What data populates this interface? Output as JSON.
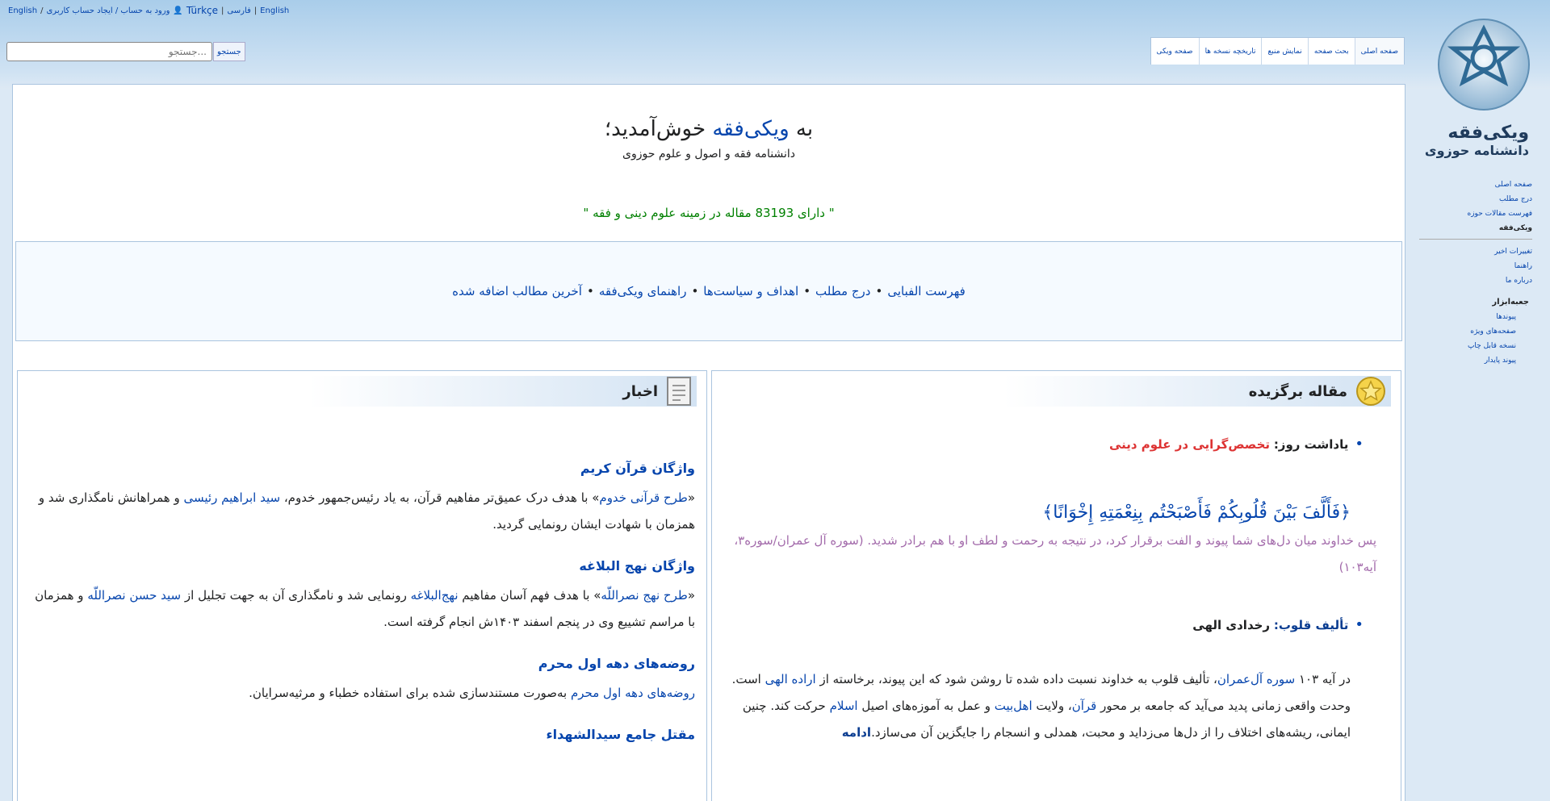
{
  "personal": {
    "items": [
      "ورود به حساب / ایجاد حساب کاربری",
      "Türkçe",
      "فارسی",
      "English"
    ]
  },
  "search": {
    "placeholder": "جستجو...",
    "button_label": "جستجو"
  },
  "tabs": [
    {
      "label": "صفحه اصلی",
      "selected": true
    },
    {
      "label": "بحث صفحه",
      "selected": false
    },
    {
      "label": "نمایش منبع",
      "selected": false
    },
    {
      "label": "تاریخچه نسخه ها",
      "selected": false
    },
    {
      "label": "صفحه ویکی",
      "selected": false
    }
  ],
  "logo": {
    "text_line1": "ویکی‌فقه",
    "text_line2": "دانشنامه حوزوی"
  },
  "sidebar": {
    "items1": [
      "صفحه اصلی",
      "درج مطلب",
      "فهرست مقالات حوزه",
      "ویکی‌فقه"
    ],
    "items2": [
      "تغییرات اخیر",
      "راهنما",
      "درباره ما"
    ],
    "section_head": "جعبه‌ابزار",
    "items3": [
      "پیوندها",
      "صفحه‌های ویژه",
      "نسخه قابل چاپ",
      "پیوند پایدار"
    ]
  },
  "welcome": {
    "prefix": "به ",
    "site": "ویکی‌فقه",
    "suffix": " خوش‌آمدید؛",
    "subtitle": "دانشنامه فقه و اصول و علوم حوزوی"
  },
  "article_count_text": "\" دارای 83193 مقاله در زمینه علوم دینی و فقه \"",
  "navbox": [
    "فهرست الفبایی",
    "درج مطلب",
    "اهداف و سیاست‌ها",
    "راهنمای ویکی‌فقه",
    "آخرین مطالب اضافه شده"
  ],
  "featured": {
    "title": "مقاله برگزیده",
    "note_label": "یاداشت روز:",
    "note_link": "تخصص‌گرایی در علوم دینی",
    "quote": "﴿فَأَلَّفَ بَيْنَ قُلُوبِكُمْ فَأَصْبَحْتُم بِنِعْمَتِهِ إِخْوَانًا﴾",
    "translation": "پس خداوند میان دل‌های شما پیوند و الفت برقرار کرد، در نتیجه به رحمت و لطف او با هم برادر شدید. (سوره آل عمران/سوره۳، آیه۱۰۳)",
    "sub_label": "تألیف قلوب:",
    "sub_title": "رخدادی الهی",
    "p1": "در آیه ۱۰۳",
    "p1_link1": "سوره آل‌عمران",
    "p2": "، تألیف قلوب به خداوند نسبت داده شده تا روشن شود که این پیوند، برخاسته از",
    "p2_link": "اراده الهی",
    "p3": "است. وحدت واقعی زمانی پدید می‌آید که جامعه بر محور",
    "p3_link1": "قرآن",
    "p3b": "، ولایت",
    "p3_link2": "اهل‌بیت",
    "p3c": "و عمل به آموزه‌های اصیل",
    "p3_link3": "اسلام",
    "p3d": "حرکت کند. چنین ایمانی، ریشه‌های اختلاف را از دل‌ها می‌زداید و محبت، همدلی و انسجام را جایگزین آن می‌سازد.",
    "more": "ادامه"
  },
  "news": {
    "title": "اخبار",
    "s1_head": "واژگان قرآن کریم",
    "s1_a": "«",
    "s1_link1": "طرح قرآنی خدوم",
    "s1_b": "» با هدف درک عمیق‌تر مفاهیم قرآن، به یاد رئیس‌جمهور خدوم،",
    "s1_link2": "سید ابراهیم رئیسی",
    "s1_c": "و همراهانش نامگذاری شد و همزمان با شهادت ایشان رونمایی گردید.",
    "s2_head": "واژگان نهج البلاغه",
    "s2_a": "«",
    "s2_link1": "طرح نهج نصراللّه",
    "s2_b": "» با هدف فهم آسان مفاهیم",
    "s2_link2": "نهج‌البلاغه",
    "s2_c": "رونمایی شد و نامگذاری آن به جهت تجلیل از",
    "s2_link3": "سید حسن نصراللّه",
    "s2_d": "و همزمان با مراسم تشییع وی در پنجم اسفند ۱۴۰۳ش انجام گرفته است.",
    "s3_head": "روضه‌های دهه اول محرم",
    "s3_link": "روضه‌های دهه اول محرم",
    "s3_text": "به‌صورت مستندسازی شده برای استفاده خطباء و مرثیه‌سرایان.",
    "s4_head": "مقتل جامع سیدالشهداء"
  }
}
